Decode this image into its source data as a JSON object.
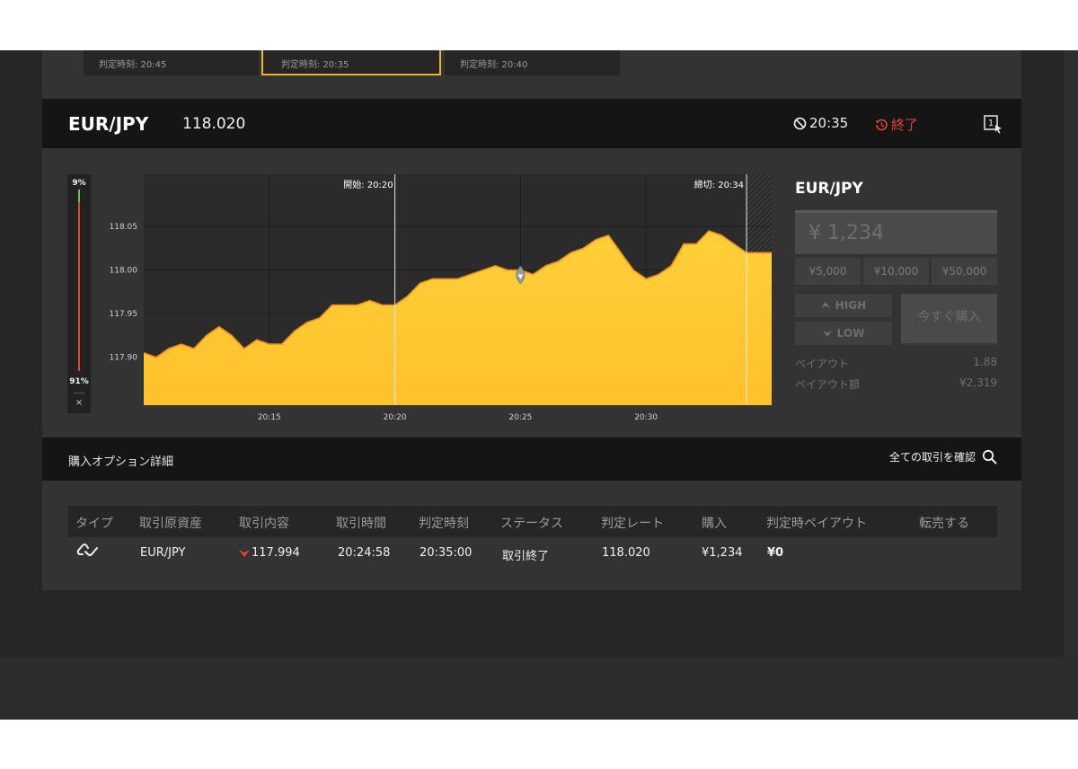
{
  "top_cards": [
    {
      "label": "判定時刻: 20:45",
      "active": false
    },
    {
      "label": "判定時刻: 20:35",
      "active": true
    },
    {
      "label": "判定時刻: 20:40",
      "active": false
    }
  ],
  "header": {
    "pair": "EUR/JPY",
    "rate": "118.020",
    "judge_time": "20:35",
    "status": "終了",
    "icon": "window-cursor-icon"
  },
  "gauge": {
    "high_pct": "9%",
    "low_pct": "91%",
    "close": "×"
  },
  "chart_data": {
    "type": "area",
    "y_ticks": [
      "118.05",
      "118.00",
      "117.95",
      "117.90"
    ],
    "x_ticks": [
      "20:15",
      "20:20",
      "20:25",
      "20:30"
    ],
    "ylim": [
      117.845,
      118.11
    ],
    "xlim_minutes": [
      "20:10",
      "20:35"
    ],
    "start_marker": "開始: 20:20",
    "deadline_marker": "締切: 20:34",
    "entry_rate": 117.994,
    "series": [
      {
        "x": [
          "20:10",
          "20:10:30",
          "20:11",
          "20:11:30",
          "20:12",
          "20:12:30",
          "20:13",
          "20:13:30",
          "20:14",
          "20:14:30",
          "20:15",
          "20:15:30",
          "20:16",
          "20:16:30",
          "20:17",
          "20:17:30",
          "20:18",
          "20:18:30",
          "20:19",
          "20:19:30",
          "20:20",
          "20:20:30",
          "20:21",
          "20:21:30",
          "20:22",
          "20:22:30",
          "20:23",
          "20:23:30",
          "20:24",
          "20:24:30",
          "20:25",
          "20:25:30",
          "20:26",
          "20:26:30",
          "20:27",
          "20:27:30",
          "20:28",
          "20:28:30",
          "20:29",
          "20:29:30",
          "20:30",
          "20:30:30",
          "20:31",
          "20:31:30",
          "20:32",
          "20:32:30",
          "20:33",
          "20:33:30",
          "20:34",
          "20:34:30",
          "20:35"
        ],
        "values": [
          117.905,
          117.9,
          117.91,
          117.915,
          117.91,
          117.925,
          117.935,
          117.925,
          117.91,
          117.92,
          117.915,
          117.915,
          117.93,
          117.94,
          117.945,
          117.96,
          117.96,
          117.96,
          117.965,
          117.96,
          117.96,
          117.97,
          117.985,
          117.99,
          117.99,
          117.99,
          117.995,
          118.0,
          118.005,
          118.0,
          118.0,
          117.995,
          118.005,
          118.01,
          118.02,
          118.025,
          118.035,
          118.04,
          118.02,
          118.0,
          117.99,
          117.995,
          118.005,
          118.03,
          118.03,
          118.045,
          118.04,
          118.03,
          118.02,
          118.02,
          118.02
        ]
      }
    ]
  },
  "trade": {
    "pair": "EUR/JPY",
    "amount_placeholder": "¥ 1,234",
    "quick": [
      "¥5,000",
      "¥10,000",
      "¥50,000"
    ],
    "high": "HIGH",
    "low": "LOW",
    "buy_now": "今すぐ購入",
    "payout_label": "ペイアウト",
    "payout_value": "1.88",
    "payout_amount_label": "ペイアウト額",
    "payout_amount_value": "¥2,319"
  },
  "details": {
    "title": "購入オプション詳細",
    "link": "全ての取引を確認"
  },
  "table": {
    "headers": [
      "タイプ",
      "取引原資産",
      "取引内容",
      "取引時間",
      "判定時刻",
      "ステータス",
      "判定レート",
      "購入",
      "判定時ペイアウト",
      "転売する"
    ],
    "row": {
      "type_icon": "ladder-type-icon",
      "asset": "EUR/JPY",
      "content": "117.994",
      "trade_time": "20:24:58",
      "judge_time": "20:35:00",
      "status": "取引終了",
      "judge_rate": "118.020",
      "purchase": "¥1,234",
      "payout": "¥0"
    }
  }
}
